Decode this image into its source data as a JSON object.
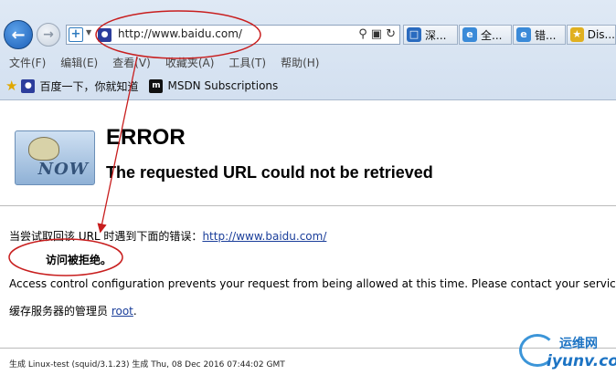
{
  "browser": {
    "address_url": "http://www.baidu.com/",
    "tabs": [
      {
        "label": "深...",
        "icon": "news-icon",
        "color": "#2a6bbf"
      },
      {
        "label": "全...",
        "icon": "ie-icon",
        "color": "#3a8ad8"
      },
      {
        "label": "错...",
        "icon": "ie-icon",
        "color": "#3a8ad8"
      },
      {
        "label": "Dis...",
        "icon": "trophy-icon",
        "color": "#e0b020"
      }
    ],
    "menu": [
      "文件(F)",
      "编辑(E)",
      "查看(V)",
      "收藏夹(A)",
      "工具(T)",
      "帮助(H)"
    ],
    "favorites": [
      {
        "label": "百度一下，你就知道",
        "icon": "baidu-paw-icon"
      },
      {
        "label": "MSDN Subscriptions",
        "icon": "msdn-icon"
      }
    ]
  },
  "page": {
    "logo_text": "NOW",
    "error_title": "ERROR",
    "error_subtitle": "The requested URL could not be retrieved",
    "line1_prefix": "当尝试取回该 URL 时遇到下面的错误：",
    "line1_link": "http://www.baidu.com/",
    "line2": "访问被拒绝。",
    "line3": "Access control configuration prevents your request from being allowed at this time. Please contact your servic",
    "line4_prefix": "缓存服务器的管理员 ",
    "line4_link": "root",
    "line4_suffix": ".",
    "footer": "生成 Linux-test (squid/3.1.23) 生成 Thu, 08 Dec 2016 07:44:02 GMT"
  },
  "watermark": {
    "top": "运维网",
    "bottom": "iyunv.com"
  },
  "colors": {
    "annotation": "#c81e1e",
    "link": "#1a3e9a"
  }
}
